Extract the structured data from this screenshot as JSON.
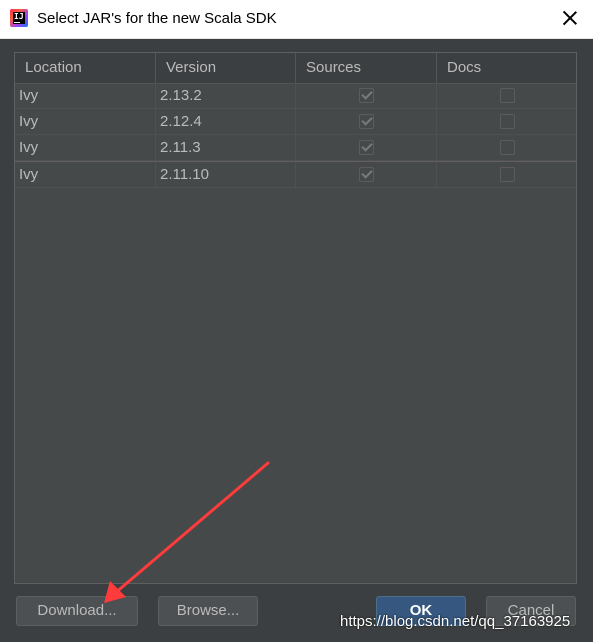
{
  "window": {
    "title": "Select JAR's for the new Scala SDK"
  },
  "table": {
    "columns": [
      "Location",
      "Version",
      "Sources",
      "Docs"
    ],
    "rows": [
      {
        "location": "Ivy",
        "version": "2.13.2",
        "sources": true,
        "docs": false
      },
      {
        "location": "Ivy",
        "version": "2.12.4",
        "sources": true,
        "docs": false
      },
      {
        "location": "Ivy",
        "version": "2.11.3",
        "sources": true,
        "docs": false
      },
      {
        "location": "Ivy",
        "version": "2.11.10",
        "sources": true,
        "docs": false
      }
    ]
  },
  "buttons": {
    "download": "Download...",
    "browse": "Browse...",
    "ok": "OK",
    "cancel": "Cancel"
  },
  "annotation": {
    "arrow_color": "#ff3b3b"
  },
  "watermark": "https://blog.csdn.net/qq_37163925"
}
